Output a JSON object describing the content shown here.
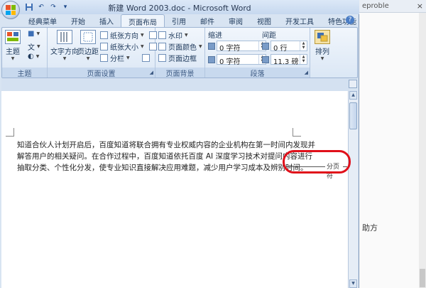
{
  "window": {
    "title": "新建 Word 2003.doc - Microsoft Word"
  },
  "background_browser": {
    "tab_text": "eproble",
    "close_glyph": "×",
    "side_text": "助方"
  },
  "quick_access": {
    "save_icon": "save-icon",
    "undo_glyph": "↶",
    "redo_glyph": "↷",
    "customize_glyph": "▾"
  },
  "tabs": [
    "经典菜单",
    "开始",
    "插入",
    "页面布局",
    "引用",
    "邮件",
    "审阅",
    "视图",
    "开发工具",
    "特色功能"
  ],
  "active_tab": "页面布局",
  "help_glyph": "?",
  "ribbon": {
    "theme_group": {
      "label": "主题",
      "theme_button": "主题",
      "colors_glyph": "■",
      "fonts_glyph": "文",
      "effects_glyph": "◐"
    },
    "page_setup_group": {
      "label": "页面设置",
      "text_direction": "文字方向",
      "margins": "页边距",
      "orientation": "纸张方向",
      "size": "纸张大小",
      "columns": "分栏"
    },
    "page_background_group": {
      "label": "页面背景",
      "watermark": "水印",
      "page_color": "页面颜色",
      "page_borders": "页面边框"
    },
    "paragraph_group": {
      "label": "段落",
      "indent_label": "缩进",
      "spacing_label": "间距",
      "indent_left": "0 字符",
      "indent_right": "0 字符",
      "spacing_before": "0 行",
      "spacing_after": "11.3 磅"
    },
    "arrange_group": {
      "arrange": "排列"
    }
  },
  "document": {
    "lines": [
      "知道合伙人计划开启后，百度知道将联合拥有专业权威内容的企业机构在第一时间内发现并",
      "解答用户的相关疑问。在合作过程中，百度知道依托百度 AI 深度学习技术对提问内容进行",
      "抽取分类、个性化分发，使专业知识直接解决应用难题，减少用户学习成本及辨别时间。"
    ],
    "page_break_label": "分页符"
  }
}
